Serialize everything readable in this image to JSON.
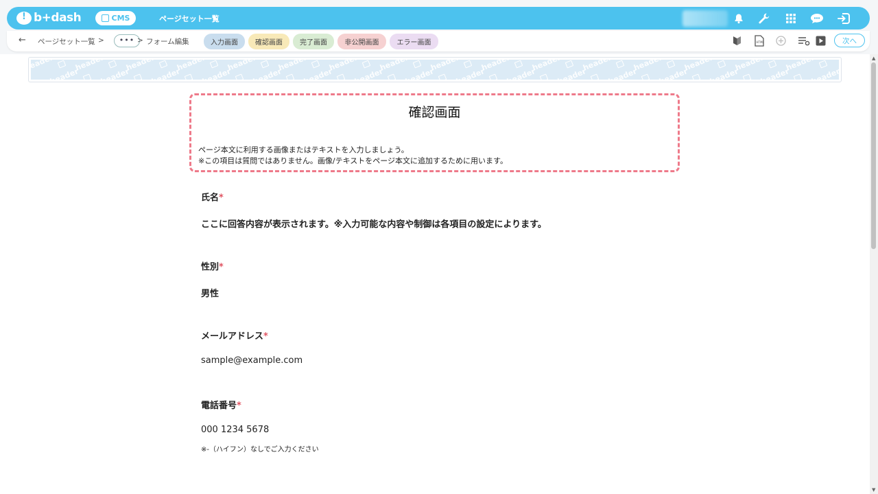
{
  "topbar": {
    "logo_text": "b+dash",
    "cms_label": "CMS",
    "title": "ページセット一覧",
    "icons": [
      "bell-icon",
      "wrench-icon",
      "grid-icon",
      "chat-icon",
      "logout-icon"
    ]
  },
  "breadcrumb": {
    "items": [
      "ページセット一覧",
      "•••",
      "フォーム編集"
    ],
    "separator": ">"
  },
  "tabs": [
    {
      "label": "入力画面",
      "color": "#c9ddee"
    },
    {
      "label": "確認画面",
      "color": "#f8e9b8"
    },
    {
      "label": "完了画面",
      "color": "#d9ecd3"
    },
    {
      "label": "非公開画面",
      "color": "#f6d1d1"
    },
    {
      "label": "エラー画面",
      "color": "#ebdcf2"
    }
  ],
  "toolbar": {
    "icons": [
      "beginner-icon",
      "html-file-icon",
      "add-circle-icon",
      "list-settings-icon",
      "play-icon"
    ],
    "next_label": "次へ"
  },
  "header_area": {
    "watermark": "header"
  },
  "confirm_box": {
    "title": "確認画面",
    "note_line1": "ページ本文に利用する画像またはテキストを入力しましょう。",
    "note_line2": "※この項目は質問ではありません。画像/テキストをページ本文に追加するために用います。"
  },
  "fields": [
    {
      "label": "氏名",
      "required": "*",
      "value": "ここに回答内容が表示されます。※入力可能な内容や制御は各項目の設定によります。"
    },
    {
      "label": "性別",
      "required": "*",
      "value": "男性"
    },
    {
      "label": "メールアドレス",
      "required": "*",
      "value": "sample@example.com"
    },
    {
      "label": "電話番号",
      "required": "*",
      "value": "000 1234 5678",
      "note": "※-（ハイフン）なしでご入力ください"
    }
  ],
  "colors": {
    "brand": "#4cc2ee",
    "required": "#e05563",
    "dashed_border": "#ee7a8a"
  }
}
